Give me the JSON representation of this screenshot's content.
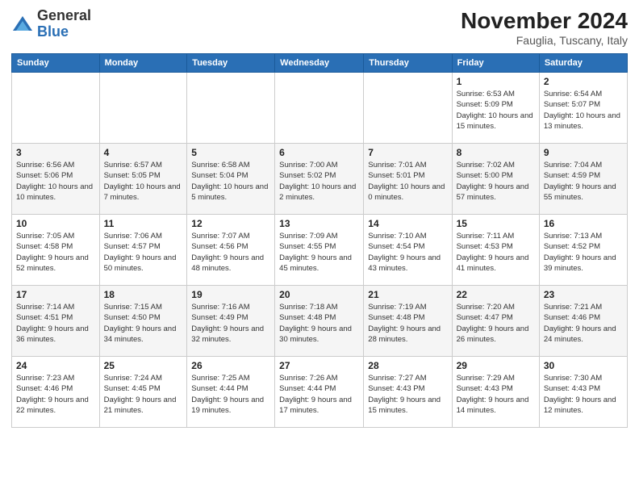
{
  "logo": {
    "general": "General",
    "blue": "Blue"
  },
  "header": {
    "month": "November 2024",
    "location": "Fauglia, Tuscany, Italy"
  },
  "days_of_week": [
    "Sunday",
    "Monday",
    "Tuesday",
    "Wednesday",
    "Thursday",
    "Friday",
    "Saturday"
  ],
  "weeks": [
    [
      {
        "day": "",
        "info": ""
      },
      {
        "day": "",
        "info": ""
      },
      {
        "day": "",
        "info": ""
      },
      {
        "day": "",
        "info": ""
      },
      {
        "day": "",
        "info": ""
      },
      {
        "day": "1",
        "info": "Sunrise: 6:53 AM\nSunset: 5:09 PM\nDaylight: 10 hours and 15 minutes."
      },
      {
        "day": "2",
        "info": "Sunrise: 6:54 AM\nSunset: 5:07 PM\nDaylight: 10 hours and 13 minutes."
      }
    ],
    [
      {
        "day": "3",
        "info": "Sunrise: 6:56 AM\nSunset: 5:06 PM\nDaylight: 10 hours and 10 minutes."
      },
      {
        "day": "4",
        "info": "Sunrise: 6:57 AM\nSunset: 5:05 PM\nDaylight: 10 hours and 7 minutes."
      },
      {
        "day": "5",
        "info": "Sunrise: 6:58 AM\nSunset: 5:04 PM\nDaylight: 10 hours and 5 minutes."
      },
      {
        "day": "6",
        "info": "Sunrise: 7:00 AM\nSunset: 5:02 PM\nDaylight: 10 hours and 2 minutes."
      },
      {
        "day": "7",
        "info": "Sunrise: 7:01 AM\nSunset: 5:01 PM\nDaylight: 10 hours and 0 minutes."
      },
      {
        "day": "8",
        "info": "Sunrise: 7:02 AM\nSunset: 5:00 PM\nDaylight: 9 hours and 57 minutes."
      },
      {
        "day": "9",
        "info": "Sunrise: 7:04 AM\nSunset: 4:59 PM\nDaylight: 9 hours and 55 minutes."
      }
    ],
    [
      {
        "day": "10",
        "info": "Sunrise: 7:05 AM\nSunset: 4:58 PM\nDaylight: 9 hours and 52 minutes."
      },
      {
        "day": "11",
        "info": "Sunrise: 7:06 AM\nSunset: 4:57 PM\nDaylight: 9 hours and 50 minutes."
      },
      {
        "day": "12",
        "info": "Sunrise: 7:07 AM\nSunset: 4:56 PM\nDaylight: 9 hours and 48 minutes."
      },
      {
        "day": "13",
        "info": "Sunrise: 7:09 AM\nSunset: 4:55 PM\nDaylight: 9 hours and 45 minutes."
      },
      {
        "day": "14",
        "info": "Sunrise: 7:10 AM\nSunset: 4:54 PM\nDaylight: 9 hours and 43 minutes."
      },
      {
        "day": "15",
        "info": "Sunrise: 7:11 AM\nSunset: 4:53 PM\nDaylight: 9 hours and 41 minutes."
      },
      {
        "day": "16",
        "info": "Sunrise: 7:13 AM\nSunset: 4:52 PM\nDaylight: 9 hours and 39 minutes."
      }
    ],
    [
      {
        "day": "17",
        "info": "Sunrise: 7:14 AM\nSunset: 4:51 PM\nDaylight: 9 hours and 36 minutes."
      },
      {
        "day": "18",
        "info": "Sunrise: 7:15 AM\nSunset: 4:50 PM\nDaylight: 9 hours and 34 minutes."
      },
      {
        "day": "19",
        "info": "Sunrise: 7:16 AM\nSunset: 4:49 PM\nDaylight: 9 hours and 32 minutes."
      },
      {
        "day": "20",
        "info": "Sunrise: 7:18 AM\nSunset: 4:48 PM\nDaylight: 9 hours and 30 minutes."
      },
      {
        "day": "21",
        "info": "Sunrise: 7:19 AM\nSunset: 4:48 PM\nDaylight: 9 hours and 28 minutes."
      },
      {
        "day": "22",
        "info": "Sunrise: 7:20 AM\nSunset: 4:47 PM\nDaylight: 9 hours and 26 minutes."
      },
      {
        "day": "23",
        "info": "Sunrise: 7:21 AM\nSunset: 4:46 PM\nDaylight: 9 hours and 24 minutes."
      }
    ],
    [
      {
        "day": "24",
        "info": "Sunrise: 7:23 AM\nSunset: 4:46 PM\nDaylight: 9 hours and 22 minutes."
      },
      {
        "day": "25",
        "info": "Sunrise: 7:24 AM\nSunset: 4:45 PM\nDaylight: 9 hours and 21 minutes."
      },
      {
        "day": "26",
        "info": "Sunrise: 7:25 AM\nSunset: 4:44 PM\nDaylight: 9 hours and 19 minutes."
      },
      {
        "day": "27",
        "info": "Sunrise: 7:26 AM\nSunset: 4:44 PM\nDaylight: 9 hours and 17 minutes."
      },
      {
        "day": "28",
        "info": "Sunrise: 7:27 AM\nSunset: 4:43 PM\nDaylight: 9 hours and 15 minutes."
      },
      {
        "day": "29",
        "info": "Sunrise: 7:29 AM\nSunset: 4:43 PM\nDaylight: 9 hours and 14 minutes."
      },
      {
        "day": "30",
        "info": "Sunrise: 7:30 AM\nSunset: 4:43 PM\nDaylight: 9 hours and 12 minutes."
      }
    ]
  ]
}
